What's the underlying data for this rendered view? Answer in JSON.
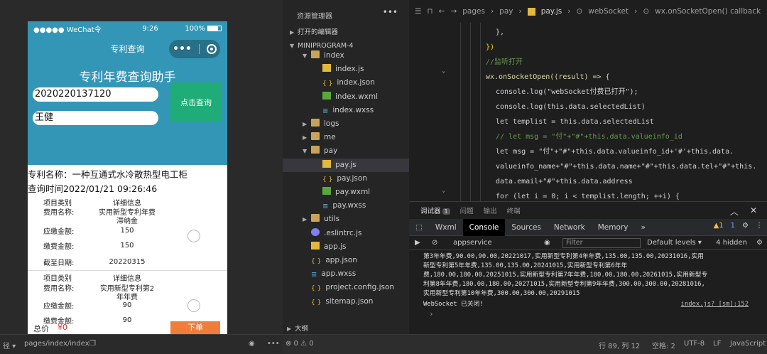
{
  "phone": {
    "status": {
      "carrier": "●●●●● WeChat令",
      "time": "9:26",
      "battery": "100%"
    },
    "nav_title": "专利查询",
    "capsule_dots": "•••",
    "app_title": "专利年费查询助手",
    "patent_number": "2020220137120",
    "applicant_name": "王健",
    "query_button": "点击查询",
    "patent_name_line": "专利名称：一种互通式水冷散热型电工柜",
    "query_time_line": "查询时间2022/01/21 09:26:46",
    "fee_cards": [
      {
        "rows": [
          {
            "label": "项目类别",
            "value": "详细信息"
          },
          {
            "label": "费用名称:",
            "value": "实用新型专利年费"
          },
          {
            "label": "",
            "value": "滞纳金"
          },
          {
            "label": "应缴金额:",
            "value": "150"
          },
          {
            "label": "缴费金额:",
            "value": "150"
          },
          {
            "label": "截至日期:",
            "value": "20220315"
          }
        ]
      },
      {
        "rows": [
          {
            "label": "项目类别",
            "value": "详细信息"
          },
          {
            "label": "费用名称:",
            "value": "实用新型专利第2"
          },
          {
            "label": "",
            "value": "年年费"
          },
          {
            "label": "应缴金额:",
            "value": "90"
          },
          {
            "label": "缴费金额:",
            "value": "90"
          }
        ]
      }
    ],
    "total_label": "总价",
    "total_amount": "¥0",
    "order_button": "下单"
  },
  "sim_footer": {
    "zoom": "径 ▾",
    "path": "pages/index/index",
    "more": "•••"
  },
  "explorer": {
    "header": "资源管理器",
    "more": "•••",
    "open_editors": "打开的编辑器",
    "project": "MINIPROGRAM-4",
    "outline": "大纲",
    "items": [
      {
        "label": "index",
        "type": "folder"
      },
      {
        "label": "index.js",
        "type": "js"
      },
      {
        "label": "index.json",
        "type": "json"
      },
      {
        "label": "index.wxml",
        "type": "wxml"
      },
      {
        "label": "index.wxss",
        "type": "wxss"
      },
      {
        "label": "logs",
        "type": "folder"
      },
      {
        "label": "me",
        "type": "folder"
      },
      {
        "label": "pay",
        "type": "folder"
      },
      {
        "label": "pay.js",
        "type": "js"
      },
      {
        "label": "pay.json",
        "type": "json"
      },
      {
        "label": "pay.wxml",
        "type": "wxml"
      },
      {
        "label": "pay.wxss",
        "type": "wxss"
      },
      {
        "label": "utils",
        "type": "folder"
      },
      {
        "label": ".eslintrc.js",
        "type": "eslint"
      },
      {
        "label": "app.js",
        "type": "js"
      },
      {
        "label": "app.json",
        "type": "json"
      },
      {
        "label": "app.wxss",
        "type": "wxss"
      },
      {
        "label": "project.config.json",
        "type": "json"
      },
      {
        "label": "sitemap.json",
        "type": "json"
      }
    ]
  },
  "breadcrumb": {
    "p1": "pages",
    "p2": "pay",
    "p3": "pay.js",
    "p4": "webSocket",
    "p5": "wx.onSocketOpen() callback"
  },
  "code_lines": [
    "},",
    "})",
    "//监听打开",
    "wx.onSocketOpen((result) => {",
    "  console.log(\"webSocket付费已打开\");",
    "  console.log(this.data.selectedList)",
    "  let templist = this.data.selectedList",
    "  // let msg = \"付\"+\"#\"+this.data.valueinfo_id",
    "  let msg = \"付\"+\"#\"+this.data.valueinfo_id+'#'+this.data.",
    "  valueinfo_name+\"#\"+this.data.name+\"#\"+this.data.tel+\"#\"+this.",
    "  data.email+\"#\"+this.data.address",
    "  for (let i = 0; i < templist.length; ++i) {"
  ],
  "debug": {
    "tabs": [
      "调试器",
      "问题",
      "输出",
      "终端"
    ],
    "badge": "1",
    "devtools_tabs": [
      "Wxml",
      "Console",
      "Sources",
      "Network",
      "Memory",
      "»"
    ],
    "warnings": "▲1",
    "errors": "1",
    "context": "appservice",
    "filter_placeholder": "Filter",
    "levels": "Default levels ▾",
    "hidden": "4 hidden",
    "output_lines": [
      "第3年年费,90.00,90.00,20221017,实用新型专利第4年年费,135.00,135.00,20231016,实用",
      "新型专利第5年年费,135.00,135.00,20241015,实用新型专利第6年年",
      "费,180.00,180.00,20251015,实用新型专利第7年年费,180.00,180.00,20261015,实用新型专",
      "利第8年年费,180.00,180.00,20271015,实用新型专利第9年年费,300.00,300.00,20281016,",
      "实用新型专利第10年年费,300.00,300.00,20291015"
    ],
    "message": "WebSocket 已关闭!",
    "source": "index.js? [sm]:152",
    "prompt": "›"
  },
  "statusbar": {
    "problems": "⊗ 0 ⚠ 0",
    "position": "行 89, 列 12",
    "spaces": "空格: 2",
    "encoding": "UTF-8",
    "eol": "LF",
    "lang": "JavaScript"
  }
}
